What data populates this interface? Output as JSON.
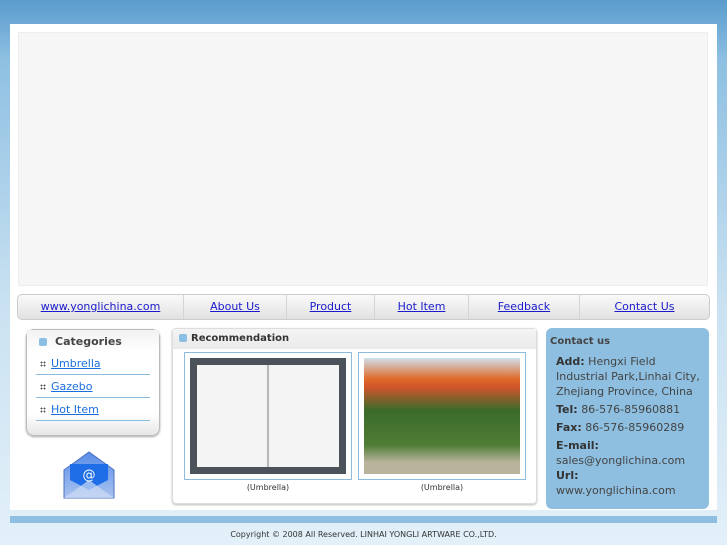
{
  "nav": [
    "www.yonglichina.com",
    "About Us",
    "Product",
    "Hot Item",
    "Feedback",
    "Contact Us"
  ],
  "categories": {
    "title": "Categories",
    "items": [
      "Umbrella",
      "Gazebo",
      "Hot Item"
    ]
  },
  "recommendation": {
    "title": "Recommendation",
    "products": [
      {
        "caption": "(Umbrella)"
      },
      {
        "caption": "(Umbrella)"
      }
    ]
  },
  "contact": {
    "title": "Contact us",
    "add_label": "Add:",
    "add": "Hengxi Field Industrial Park,Linhai City, Zhejiang Province, China",
    "tel_label": "Tel:",
    "tel": "86-576-85960881",
    "fax_label": "Fax:",
    "fax": "86-576-85960289",
    "email_label": "E-mail:",
    "email": "sales@yonglichina.com",
    "url_label": "Url:",
    "url": "www.yonglichina.com"
  },
  "footer": "Copyright © 2008 All Reserved. LINHAI YONGLI ARTWARE CO.,LTD."
}
